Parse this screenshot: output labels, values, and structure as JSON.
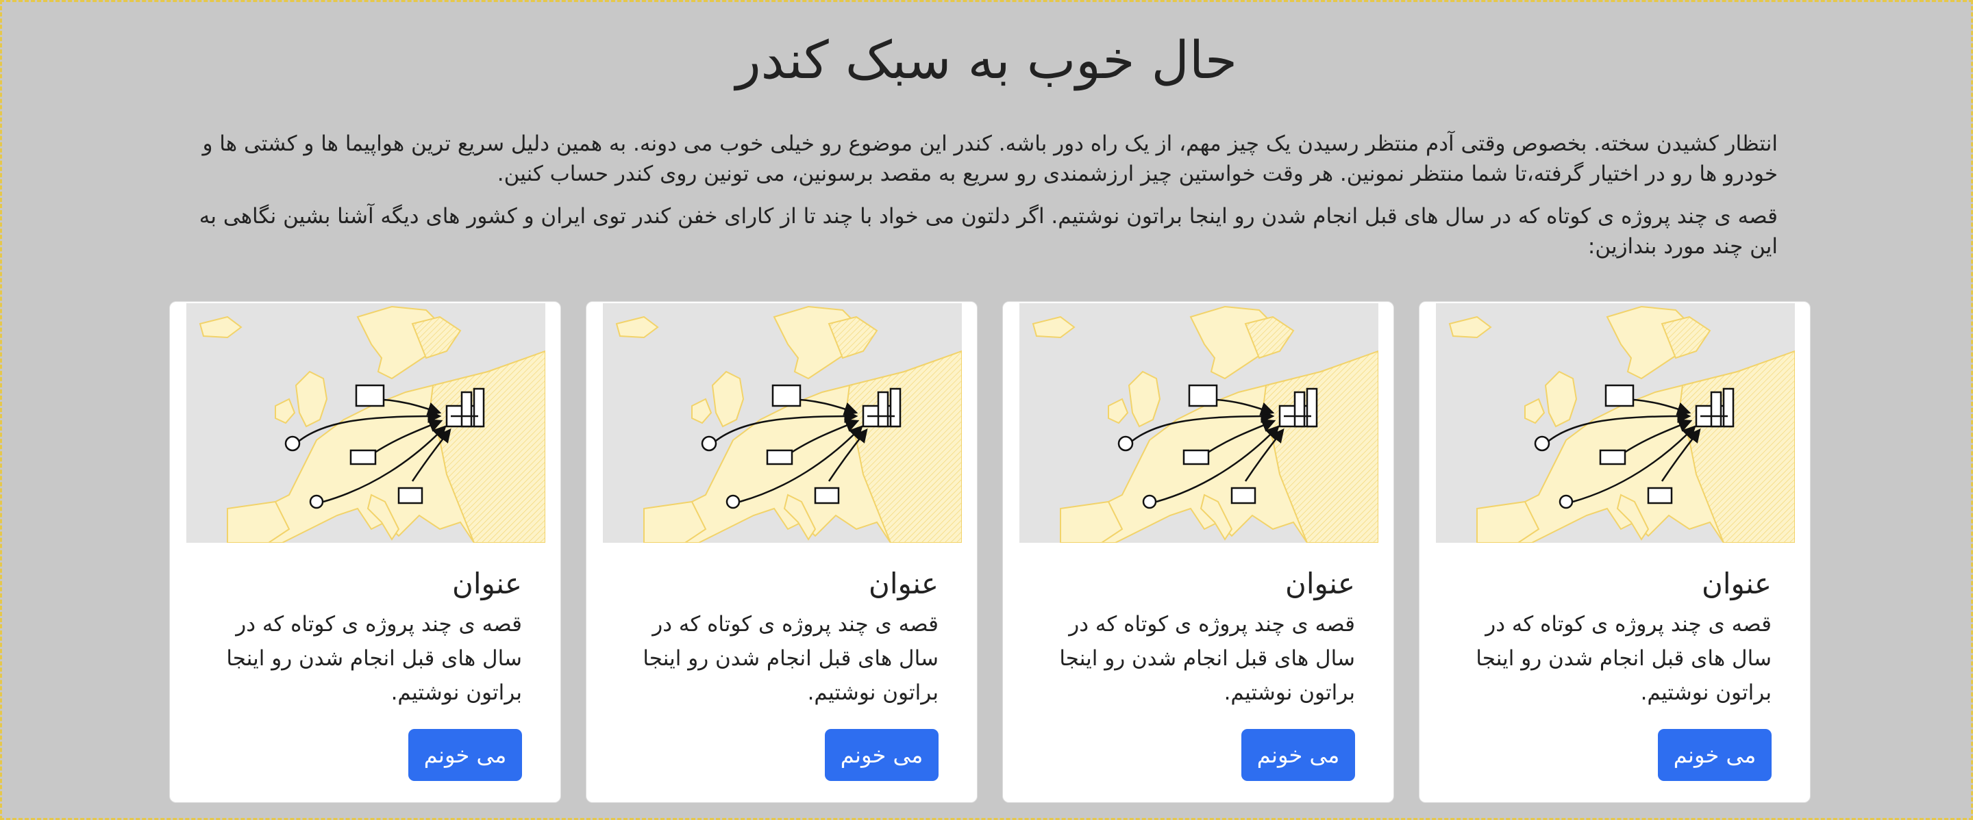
{
  "header": {
    "title": "حال خوب به سبک کندر",
    "intro_1": "انتظار کشیدن سخته. بخصوص وقتی آدم منتظر رسیدن یک چیز مهم، از یک راه دور باشه. کندر این موضوع رو خیلی خوب می دونه. به همین دلیل سریع ترین هواپیما ها و کشتی ها و خودرو ها رو در اختیار گرفته،تا شما منتظر نمونین. هر وقت خواستین چیز ارزشمندی رو سریع به مقصد برسونین، می تونین روی کندر حساب کنین.",
    "intro_2": "قصه ی چند پروژه ی کوتاه که در سال های قبل انجام شدن رو اینجا براتون نوشتیم. اگر دلتون می خواد با چند تا از کارای خفن کندر توی ایران و کشور های دیگه آشنا بشین نگاهی به این چند مورد بندازین:"
  },
  "cards": [
    {
      "title": "عنوان",
      "text": "قصه ی چند پروژه ی کوتاه که در سال های قبل انجام شدن رو اینجا براتون نوشتیم.",
      "button": "می خونم"
    },
    {
      "title": "عنوان",
      "text": "قصه ی چند پروژه ی کوتاه که در سال های قبل انجام شدن رو اینجا براتون نوشتیم.",
      "button": "می خونم"
    },
    {
      "title": "عنوان",
      "text": "قصه ی چند پروژه ی کوتاه که در سال های قبل انجام شدن رو اینجا براتون نوشتیم.",
      "button": "می خونم"
    },
    {
      "title": "عنوان",
      "text": "قصه ی چند پروژه ی کوتاه که در سال های قبل انجام شدن رو اینجا براتون نوشتیم.",
      "button": "می خونم"
    }
  ],
  "icons": {
    "card_image": "europe-logistics-map-illustration"
  },
  "colors": {
    "background": "#c8c8c8",
    "card": "#ffffff",
    "button": "#2e6ef0",
    "map_land": "#fdf3c8",
    "map_border": "#f2d36a",
    "map_sea": "#e3e3e3"
  }
}
